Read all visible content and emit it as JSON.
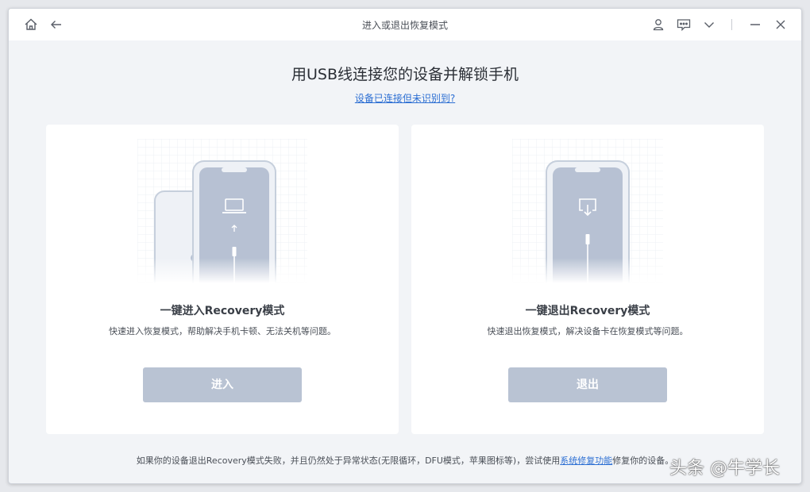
{
  "window": {
    "title": "进入或退出恢复模式",
    "icons": [
      "home-icon",
      "back-arrow-icon",
      "user-icon",
      "feedback-icon",
      "dropdown-chevron-icon",
      "minimize-icon",
      "close-icon"
    ]
  },
  "main": {
    "heading": "用USB线连接您的设备并解锁手机",
    "help_link": "设备已连接但未识别到?"
  },
  "cards": [
    {
      "title": "一键进入Recovery模式",
      "description": "快速进入恢复模式，帮助解决手机卡顿、无法关机等问题。",
      "button": "进入"
    },
    {
      "title": "一键退出Recovery模式",
      "description": "快速退出恢复模式，解决设备卡在恢复模式等问题。",
      "button": "退出"
    }
  ],
  "footer": {
    "text_before": "如果你的设备退出Recovery模式失败，并且仍然处于异常状态(无限循环，DFU模式，苹果图标等)，尝试使用",
    "link": "系统修复功能",
    "text_after": "修复你的设备。"
  },
  "watermark": "头条 @牛学长",
  "colors": {
    "accent_link": "#2d6fd3",
    "button_disabled": "#b9c3d3",
    "phone_fill": "#b7c1d3",
    "background": "#f2f4f7"
  }
}
